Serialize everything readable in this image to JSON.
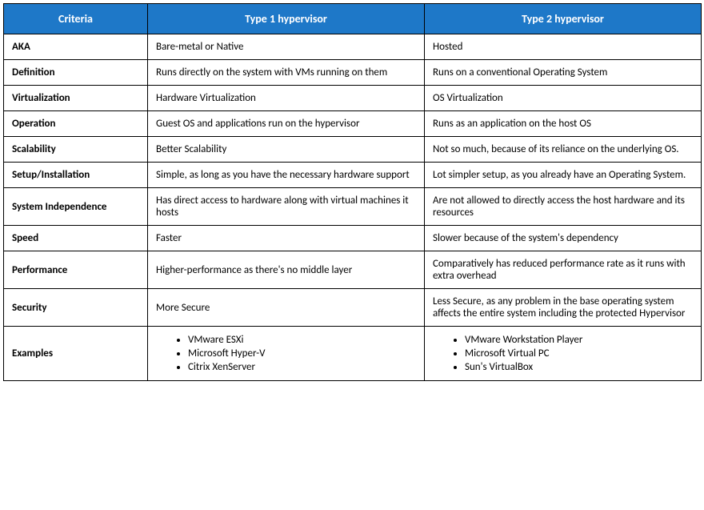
{
  "headers": {
    "criteria": "Criteria",
    "type1": "Type 1 hypervisor",
    "type2": "Type 2 hypervisor"
  },
  "rows": [
    {
      "criteria": "AKA",
      "type1": "Bare-metal or Native",
      "type2": "Hosted"
    },
    {
      "criteria": "Definition",
      "type1": "Runs directly on the system  with VMs running on them",
      "type2": "Runs on a conventional Operating System"
    },
    {
      "criteria": "Virtualization",
      "type1": "Hardware Virtualization",
      "type2": "OS Virtualization"
    },
    {
      "criteria": "Operation",
      "type1": "Guest OS and applications run on the hypervisor",
      "type2": "Runs as an application on the host OS"
    },
    {
      "criteria": "Scalability",
      "type1": "Better Scalability",
      "type2": "Not so much, because of its reliance on the underlying OS."
    },
    {
      "criteria": "Setup/Installation",
      "type1": "Simple, as long as you have the necessary hardware support",
      "type2": "Lot simpler setup, as you already have an Operating System."
    },
    {
      "criteria": "System Independence",
      "type1": "Has direct access to hardware along with virtual machines it hosts",
      "type2": "Are not allowed to directly access the host hardware and its resources"
    },
    {
      "criteria": "Speed",
      "type1": "Faster",
      "type2": "Slower because of the system's dependency"
    },
    {
      "criteria": "Performance",
      "type1": "Higher-performance as there's no middle layer",
      "type2": "Comparatively has reduced performance rate as it runs with extra overhead"
    },
    {
      "criteria": "Security",
      "type1": "More Secure",
      "type2": "Less Secure, as any problem in the base operating system affects the entire system including the protected Hypervisor"
    }
  ],
  "examples": {
    "criteria": "Examples",
    "type1": [
      "VMware ESXi",
      "Microsoft Hyper-V",
      "Citrix XenServer"
    ],
    "type2": [
      "VMware Workstation Player",
      "Microsoft Virtual PC",
      "Sun's VirtualBox"
    ]
  }
}
